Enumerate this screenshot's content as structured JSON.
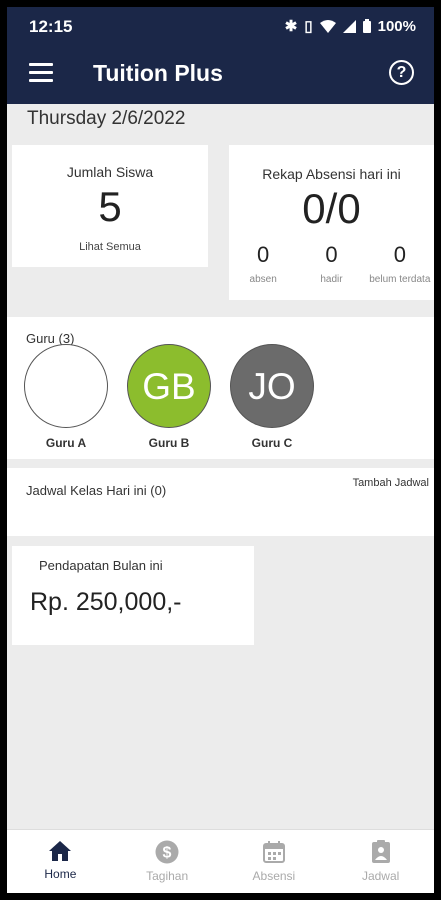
{
  "status_bar": {
    "time": "12:15",
    "battery": "100%"
  },
  "app_bar": {
    "title": "Tuition Plus",
    "help_label": "?"
  },
  "date": "Thursday 2/6/2022",
  "siswa_card": {
    "label": "Jumlah Siswa",
    "count": "5",
    "link": "Lihat Semua"
  },
  "rekap_card": {
    "label": "Rekap Absensi hari ini",
    "value": "0/0",
    "stats": [
      {
        "n": "0",
        "label": "absen"
      },
      {
        "n": "0",
        "label": "hadir"
      },
      {
        "n": "0",
        "label": "belum terdata"
      }
    ]
  },
  "guru_section": {
    "label": "Guru (3)",
    "items": [
      {
        "initials": "",
        "name": "Guru A",
        "color": "#ffffff"
      },
      {
        "initials": "GB",
        "name": "Guru B",
        "color": "#8cbd2d"
      },
      {
        "initials": "JO",
        "name": "Guru C",
        "color": "#6b6b6b"
      }
    ]
  },
  "jadwal_section": {
    "label": "Jadwal Kelas Hari ini (0)",
    "add_label": "Tambah Jadwal"
  },
  "pendapatan_card": {
    "label": "Pendapatan Bulan ini",
    "amount": "Rp.  250,000,-"
  },
  "bottom_nav": {
    "items": [
      {
        "label": "Home",
        "icon": "home-icon",
        "active": true
      },
      {
        "label": "Tagihan",
        "icon": "dollar-icon",
        "active": false
      },
      {
        "label": "Absensi",
        "icon": "calendar-icon",
        "active": false
      },
      {
        "label": "Jadwal",
        "icon": "schedule-icon",
        "active": false
      }
    ]
  },
  "colors": {
    "primary": "#1b2748",
    "background": "#ececec",
    "nav_inactive": "#aaaaaa"
  }
}
